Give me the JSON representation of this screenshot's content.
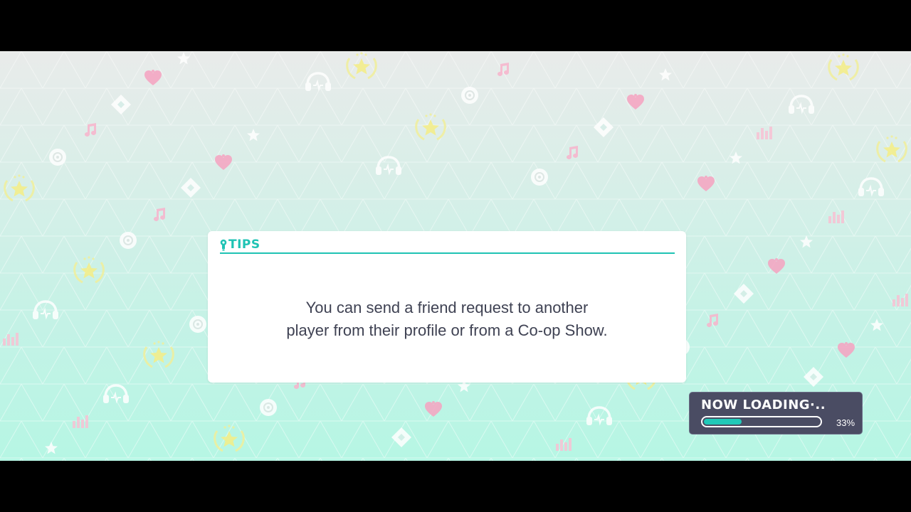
{
  "tips": {
    "icon": "lightbulb-icon",
    "title": "TIPS",
    "lines": [
      "You can send a friend request to another",
      "player from their profile or from a Co-op Show."
    ],
    "accent_color": "#1fc3b4"
  },
  "loading": {
    "label": "NOW LOADING·..",
    "percent_text": "33%",
    "progress": 0.33,
    "fill_color": "#21c9b8"
  },
  "background_icons": [
    "star-icon",
    "heart-icon",
    "music-note-icon",
    "headphones-icon",
    "disc-icon",
    "diamond-icon",
    "star-laurel-icon",
    "equalizer-icon"
  ]
}
